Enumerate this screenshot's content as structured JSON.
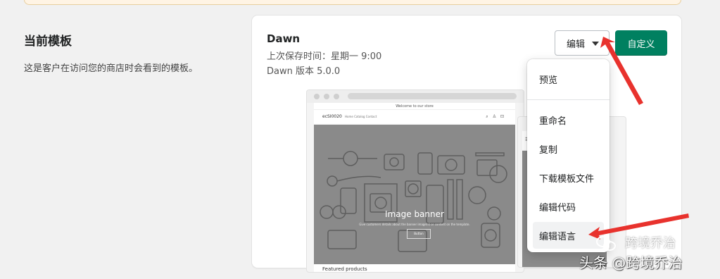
{
  "section": {
    "title": "当前模板",
    "description": "这是客户在访问您的商店时会看到的模板。"
  },
  "theme": {
    "name": "Dawn",
    "last_saved": "上次保存时间：星期一 9:00",
    "version": "Dawn 版本 5.0.0"
  },
  "actions": {
    "edit_label": "编辑",
    "customize_label": "自定义"
  },
  "dropdown": {
    "items": [
      {
        "label": "预览"
      },
      {
        "label": "重命名"
      },
      {
        "label": "复制"
      },
      {
        "label": "下载模板文件"
      },
      {
        "label": "编辑代码"
      },
      {
        "label": "编辑语言"
      }
    ]
  },
  "preview": {
    "announcement": "Welcome to our store",
    "store_name": "ecSI0020",
    "nav_links": "Home   Catalog   Contact",
    "banner_title": "Image banner",
    "banner_subtitle": "Give customers details about the banner image(s) or content on the template.",
    "banner_button": "Button",
    "featured_title": "Featured products"
  },
  "watermark": {
    "line1": "跨境乔治",
    "line2": "头条 @跨境乔治"
  },
  "colors": {
    "primary_button": "#008060",
    "annotation_arrow": "#e8322d"
  }
}
